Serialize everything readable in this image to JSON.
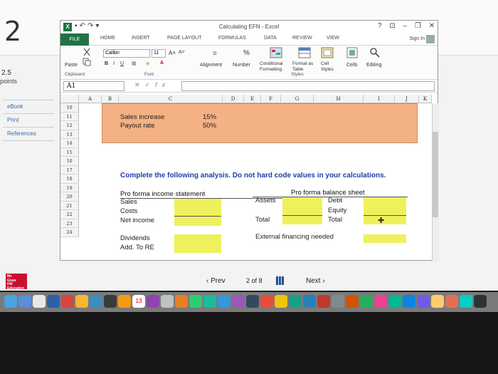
{
  "lms": {
    "question_number": "2",
    "points_value": "2.5",
    "points_label": "points",
    "sidebar": [
      "eBook",
      "Print",
      "References"
    ],
    "pagination": {
      "prev": "Prev",
      "page": "2",
      "of_label": "of",
      "total": "8",
      "next": "Next"
    },
    "logo_lines": [
      "Mc",
      "Graw",
      "Hill",
      "Education"
    ]
  },
  "excel": {
    "title": "Calculating EFN - Excel",
    "window_controls": [
      "?",
      "⊡",
      "–",
      "❐",
      "✕"
    ],
    "tabs": [
      "FILE",
      "HOME",
      "INSERT",
      "PAGE LAYOUT",
      "FORMULAS",
      "DATA",
      "REVIEW",
      "VIEW"
    ],
    "sign_in": "Sign In",
    "ribbon": {
      "font_name": "Calibri",
      "font_size": "11",
      "paste": "Paste",
      "alignment": "Alignment",
      "number": "Number",
      "conditional_formatting": "Conditional Formatting",
      "format_as_table": "Format as Table",
      "cell_styles": "Cell Styles",
      "cells": "Cells",
      "editing": "Editing",
      "groups": [
        "Clipboard",
        "Font",
        "Styles"
      ]
    },
    "formula_bar": {
      "name_box": "A1",
      "fx": "fx",
      "value": ""
    },
    "columns": [
      "A",
      "B",
      "C",
      "D",
      "E",
      "F",
      "G",
      "H",
      "I",
      "J",
      "K"
    ],
    "rows": [
      "10",
      "11",
      "12",
      "13",
      "14",
      "15",
      "16",
      "17",
      "18",
      "19",
      "20",
      "21",
      "22",
      "23",
      "24"
    ],
    "inputs": [
      {
        "label": "Sales increase",
        "value": "15%"
      },
      {
        "label": "Payout rate",
        "value": "50%"
      }
    ],
    "instruction": "Complete the following analysis. Do not hard code values in your calculations.",
    "income_statement": {
      "header": "Pro forma income statement",
      "rows": [
        "Sales",
        "Costs",
        "Net income"
      ]
    },
    "balance_sheet": {
      "header": "Pro forma balance sheet",
      "left_rows": [
        "Assets",
        "Total"
      ],
      "right_rows": [
        "Debt",
        "Equity",
        "Total"
      ]
    },
    "dividends": [
      "Dividends",
      "Add. To RE"
    ],
    "efn_label": "External financing needed",
    "colors": {
      "excel_green": "#217346",
      "input_orange": "#F4B183",
      "answer_yellow": "#EEF15C",
      "instruction_blue": "#1F3EA8"
    }
  },
  "dock": {
    "calendar_day": "13",
    "app_colors": [
      "#4aa3df",
      "#5b8dd9",
      "#e9e9e9",
      "#2e5fa9",
      "#d64541",
      "#f7b731",
      "#3c8dbc",
      "#3a3a3a",
      "#f39c12",
      "#27ae60",
      "#8e44ad",
      "#bdc3c7",
      "#e67e22",
      "#2ecc71",
      "#1abc9c",
      "#3498db",
      "#9b59b6",
      "#34495e",
      "#e74c3c",
      "#f1c40f",
      "#16a085",
      "#2980b9",
      "#c0392b",
      "#7f8c8d",
      "#d35400",
      "#27ae60",
      "#e84393",
      "#00b894",
      "#0984e3",
      "#6c5ce7",
      "#fdcb6e",
      "#e17055",
      "#00cec9",
      "#2d3436"
    ]
  }
}
